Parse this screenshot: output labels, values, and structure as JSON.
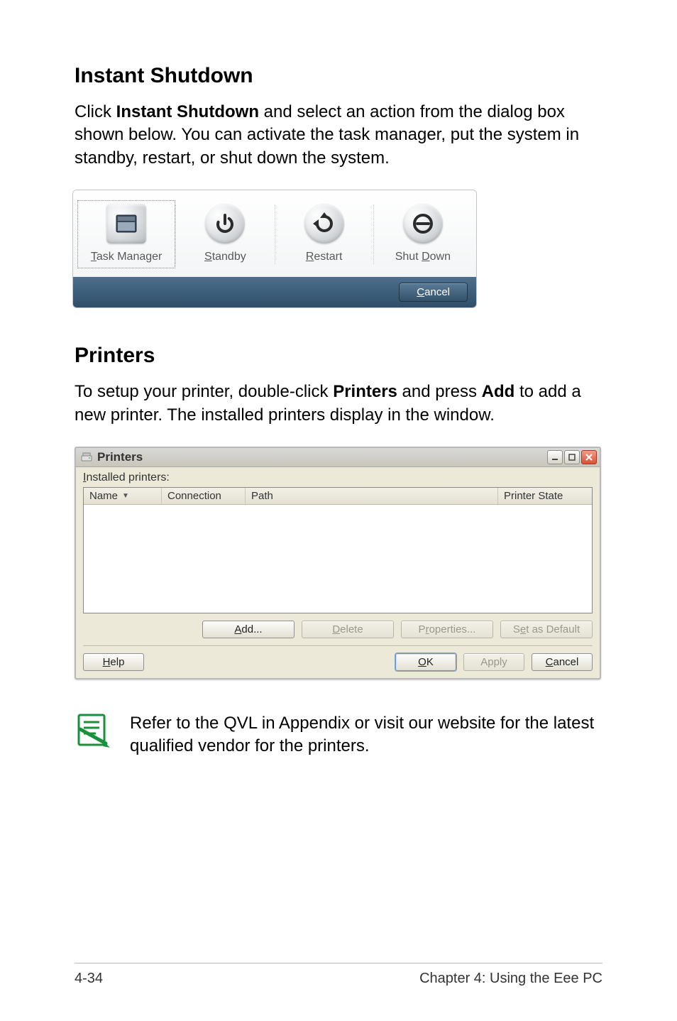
{
  "section1": {
    "heading": "Instant Shutdown",
    "para_pre": "Click ",
    "para_bold": "Instant Shutdown",
    "para_post": " and select an action from the dialog box shown below. You can activate the task manager, put the system in standby, restart, or shut down the system."
  },
  "shutdown_dialog": {
    "actions": {
      "task_manager": {
        "prefix": "T",
        "rest": "ask Manager"
      },
      "standby": {
        "prefix": "S",
        "rest": "tandby"
      },
      "restart": {
        "prefix": "R",
        "rest": "estart"
      },
      "shut_down_pre": "Shut ",
      "shut_down_prefix": "D",
      "shut_down_rest": "own"
    },
    "cancel_prefix": "C",
    "cancel_rest": "ancel"
  },
  "section2": {
    "heading": "Printers",
    "para_pre": "To setup your printer, double-click ",
    "para_bold1": "Printers",
    "para_mid": " and press ",
    "para_bold2": "Add",
    "para_post": " to add a new printer. The installed printers display in the window."
  },
  "printers_window": {
    "title": "Printers",
    "installed_label_prefix": "I",
    "installed_label_rest": "nstalled printers:",
    "columns": {
      "name": "Name",
      "connection": "Connection",
      "path": "Path",
      "state": "Printer State"
    },
    "buttons": {
      "add_prefix": "A",
      "add_rest": "dd...",
      "delete_prefix": "D",
      "delete_rest": "elete",
      "properties_pre": "P",
      "properties_mid": "r",
      "properties_rest": "operties...",
      "set_default_pre": "S",
      "set_default_mid": "e",
      "set_default_rest": "t as Default",
      "help_prefix": "H",
      "help_rest": "elp",
      "ok_prefix": "O",
      "ok_rest": "K",
      "apply": "Apply",
      "cancel_prefix": "C",
      "cancel_rest": "ancel"
    }
  },
  "note": {
    "text": "Refer to the QVL in Appendix or visit our website for the latest qualified vendor for the printers."
  },
  "footer": {
    "left": "4-34",
    "right": "Chapter 4: Using the Eee PC"
  }
}
